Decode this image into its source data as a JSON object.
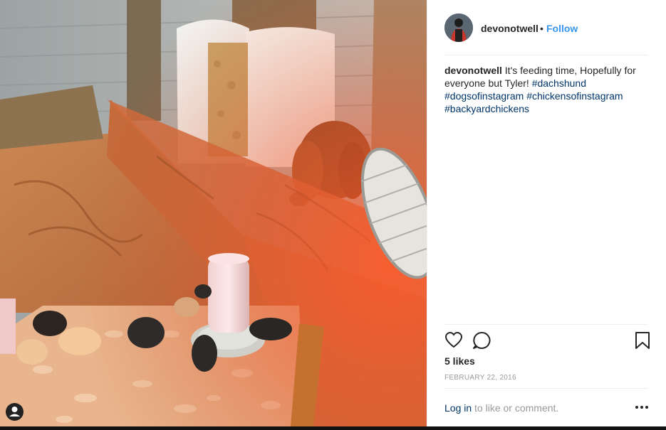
{
  "post": {
    "username": "devonotwell",
    "separator": "•",
    "follow_label": "Follow",
    "caption_text": "It's feeding time, Hopefully for everyone but Tyler!",
    "hashtags": [
      "#dachshund",
      "#dogsofinstagram",
      "#chickensofinstagram",
      "#backyardchickens"
    ],
    "likes": "5 likes",
    "date": "FEBRUARY 22, 2016",
    "login_link": "Log in",
    "login_rest": "to like or comment.",
    "more_label": "•••"
  },
  "icons": {
    "like": "heart-icon",
    "comment": "comment-icon",
    "save": "bookmark-icon",
    "more": "more-options-icon",
    "tagged_users": "user-tag-icon"
  },
  "colors": {
    "link": "#3897f0",
    "hashtag": "#003569",
    "text": "#262626",
    "muted": "#999999"
  }
}
